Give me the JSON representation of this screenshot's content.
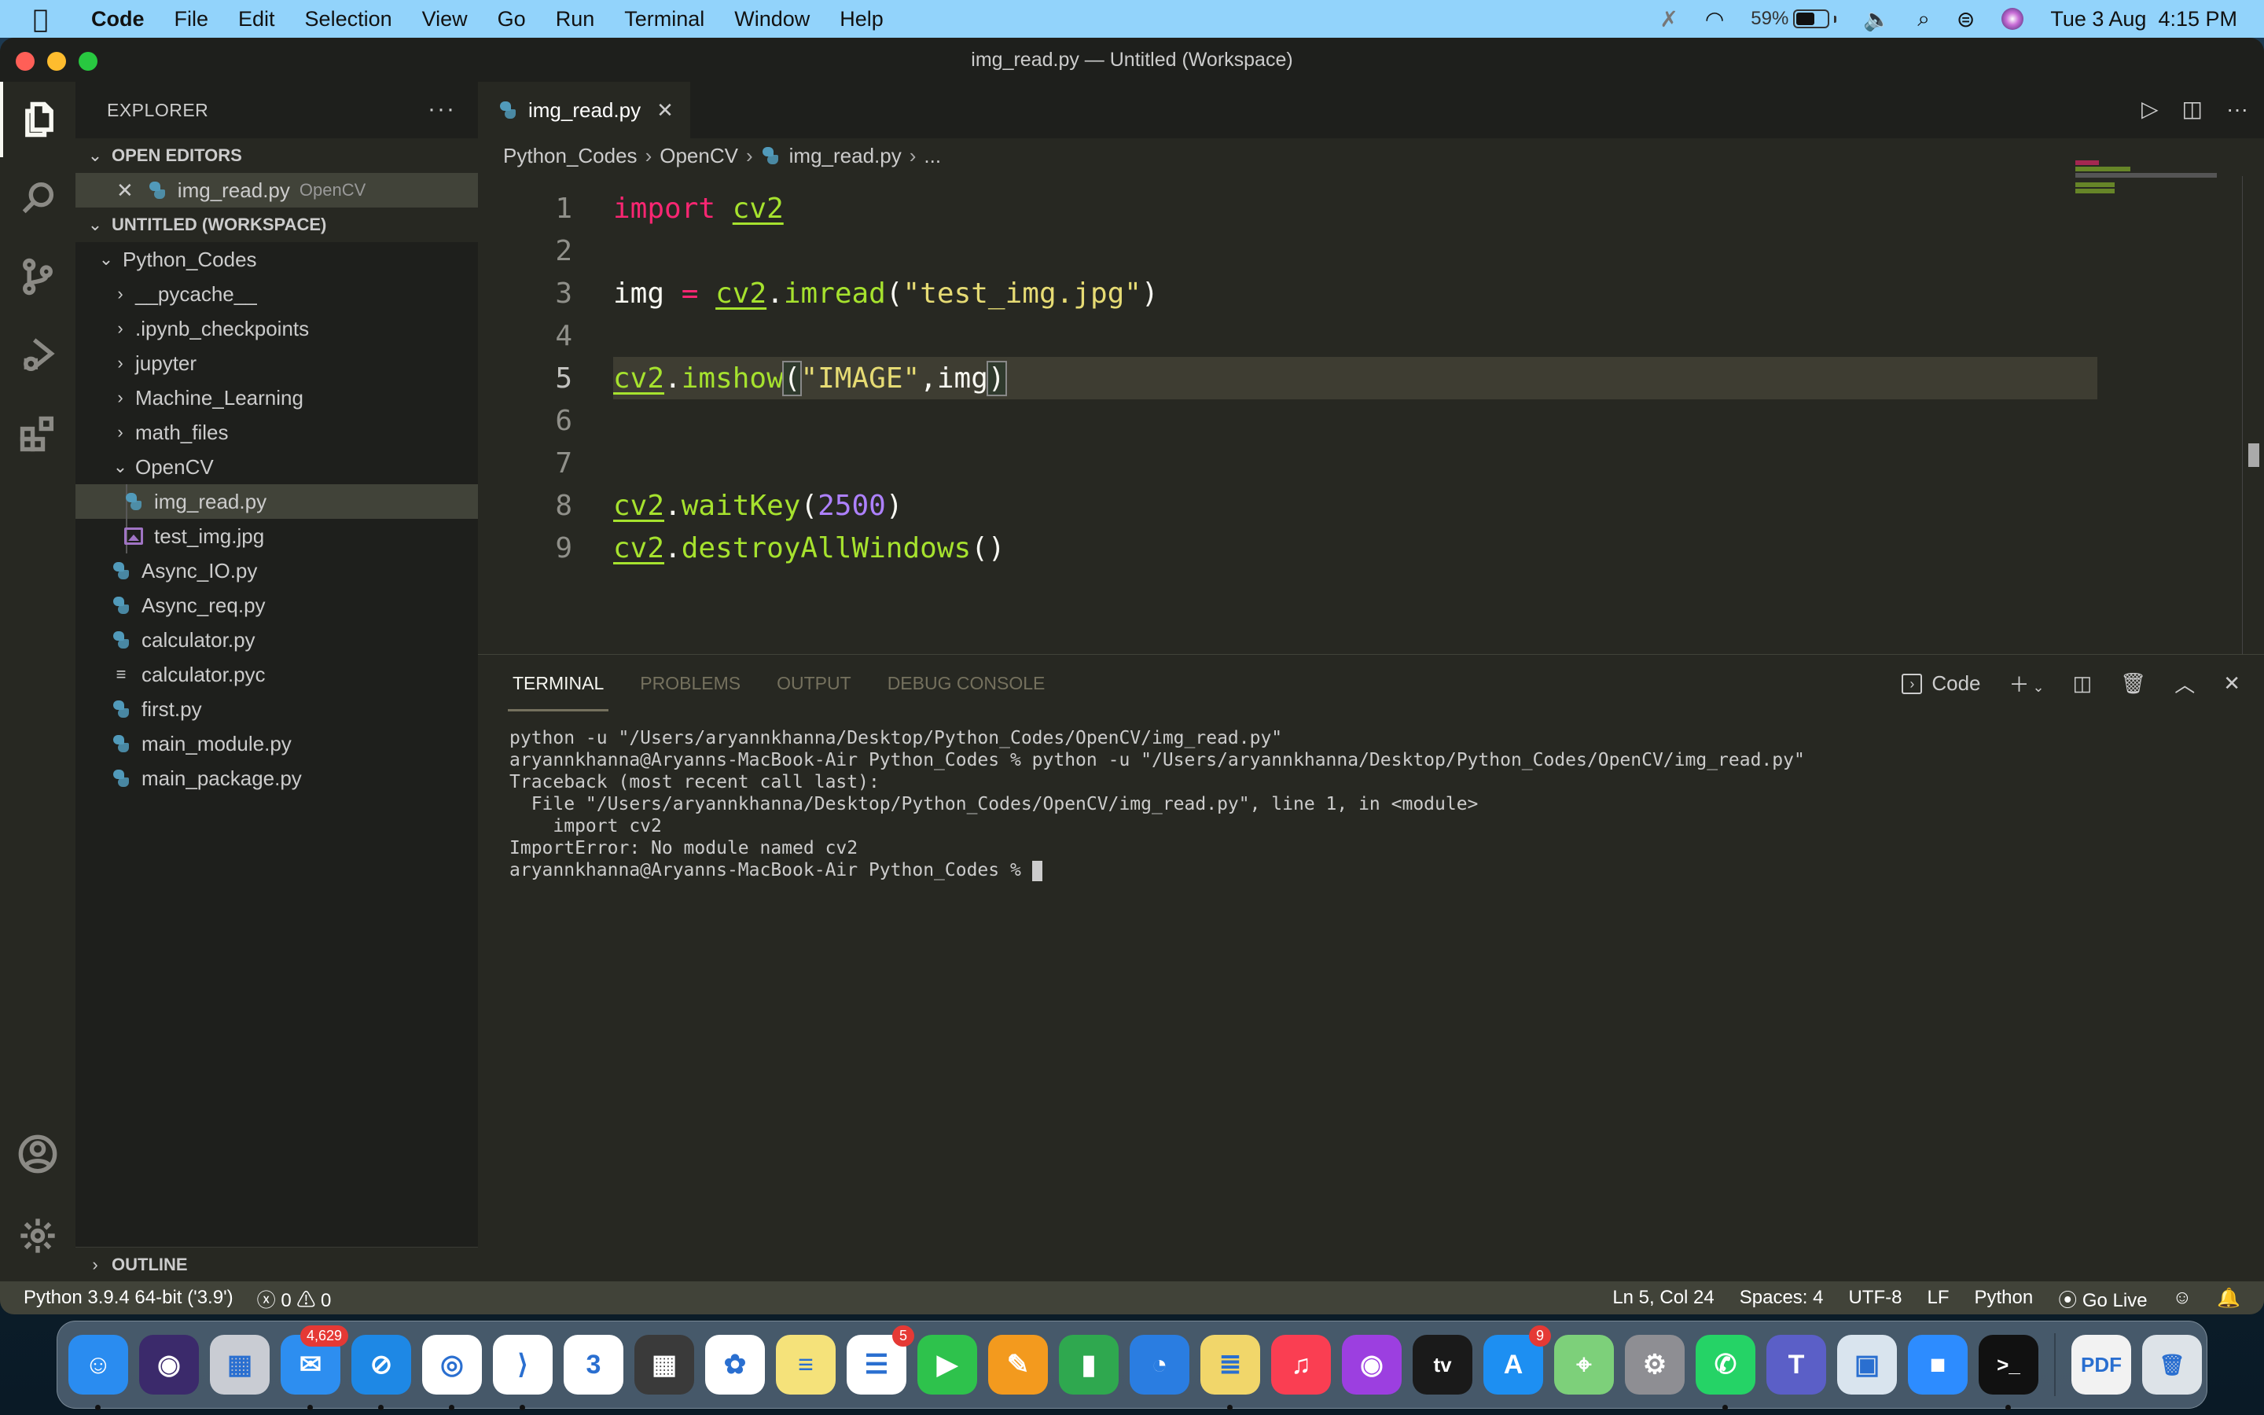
{
  "menubar": {
    "app": "Code",
    "items": [
      "File",
      "Edit",
      "Selection",
      "View",
      "Go",
      "Run",
      "Terminal",
      "Window",
      "Help"
    ],
    "battery_percent": "59%",
    "battery_level": 0.59,
    "datetime": "Tue 3 Aug  4:15 PM",
    "status_icons": [
      "bluetooth-off-icon",
      "wifi-icon",
      "battery-icon",
      "volume-icon",
      "spotlight-search-icon",
      "control-center-icon",
      "siri-icon"
    ]
  },
  "window": {
    "title": "img_read.py — Untitled (Workspace)"
  },
  "activitybar": [
    "explorer-icon",
    "search-icon",
    "source-control-icon",
    "run-debug-icon",
    "extensions-icon",
    "accounts-icon",
    "manage-gear-icon"
  ],
  "sidebar": {
    "header": "EXPLORER",
    "more": "···",
    "open_editors_label": "OPEN EDITORS",
    "open_editors": [
      {
        "name": "img_read.py",
        "desc": "OpenCV"
      }
    ],
    "workspace_label": "UNTITLED (WORKSPACE)",
    "root": "Python_Codes",
    "folders": [
      "__pycache__",
      ".ipynb_checkpoints",
      "jupyter",
      "Machine_Learning",
      "math_files"
    ],
    "open_folder": "OpenCV",
    "open_folder_files": [
      "img_read.py",
      "test_img.jpg"
    ],
    "files": [
      {
        "name": "Async_IO.py",
        "type": "python"
      },
      {
        "name": "Async_req.py",
        "type": "python"
      },
      {
        "name": "calculator.py",
        "type": "python"
      },
      {
        "name": "calculator.pyc",
        "type": "text"
      },
      {
        "name": "first.py",
        "type": "python"
      },
      {
        "name": "main_module.py",
        "type": "python"
      },
      {
        "name": "main_package.py",
        "type": "python"
      }
    ],
    "outline_label": "OUTLINE"
  },
  "editor": {
    "tab": "img_read.py",
    "breadcrumb": [
      "Python_Codes",
      "OpenCV",
      "img_read.py",
      "..."
    ],
    "line_numbers": [
      "1",
      "2",
      "3",
      "4",
      "5",
      "6",
      "7",
      "8",
      "9"
    ],
    "code": {
      "l1_kw": "import",
      "l1_mod": "cv2",
      "l3_var": "img",
      "l3_op": "=",
      "l3_mod": "cv2",
      "l3_fn": "imread",
      "l3_str": "\"test_img.jpg\"",
      "l5_mod": "cv2",
      "l5_fn": "imshow",
      "l5_str": "\"IMAGE\"",
      "l5_arg": "img",
      "l8_mod": "cv2",
      "l8_fn": "waitKey",
      "l8_num": "2500",
      "l9_mod": "cv2",
      "l9_fn": "destroyAllWindows"
    },
    "current_line": 5
  },
  "panel": {
    "tabs": [
      "TERMINAL",
      "PROBLEMS",
      "OUTPUT",
      "DEBUG CONSOLE"
    ],
    "active_tab": "TERMINAL",
    "shell_label": "Code",
    "terminal_lines": [
      "python -u \"/Users/aryannkhanna/Desktop/Python_Codes/OpenCV/img_read.py\"",
      "aryannkhanna@Aryanns-MacBook-Air Python_Codes % python -u \"/Users/aryannkhanna/Desktop/Python_Codes/OpenCV/img_read.py\"",
      "Traceback (most recent call last):",
      "  File \"/Users/aryannkhanna/Desktop/Python_Codes/OpenCV/img_read.py\", line 1, in <module>",
      "    import cv2",
      "ImportError: No module named cv2",
      "aryannkhanna@Aryanns-MacBook-Air Python_Codes % "
    ]
  },
  "statusbar": {
    "interpreter": "Python 3.9.4 64-bit ('3.9')",
    "errors": "0",
    "warnings": "0",
    "position": "Ln 5, Col 24",
    "spaces": "Spaces: 4",
    "encoding": "UTF-8",
    "eol": "LF",
    "language": "Python",
    "go_live": "Go Live"
  },
  "dock": {
    "apps": [
      {
        "name": "Finder",
        "color": "#2a8cf0",
        "glyph": "☺",
        "running": true
      },
      {
        "name": "Siri",
        "color": "#3b2a6b",
        "glyph": "◉",
        "running": false
      },
      {
        "name": "Launchpad",
        "color": "#c9ccd3",
        "glyph": "▦",
        "running": false
      },
      {
        "name": "Mail",
        "color": "#2d8ef0",
        "glyph": "✉",
        "badge": "4,629",
        "running": true
      },
      {
        "name": "Safari",
        "color": "#1e88e5",
        "glyph": "⊘",
        "running": true
      },
      {
        "name": "Chrome",
        "color": "#ffffff",
        "glyph": "◎",
        "running": true
      },
      {
        "name": "Visual Studio Code",
        "color": "#ffffff",
        "glyph": "⟩",
        "running": true
      },
      {
        "name": "Calendar",
        "color": "#ffffff",
        "glyph": "3",
        "running": false
      },
      {
        "name": "Calculator",
        "color": "#3a3a3a",
        "glyph": "▦",
        "running": false
      },
      {
        "name": "Photos",
        "color": "#ffffff",
        "glyph": "✿",
        "running": false
      },
      {
        "name": "Notes",
        "color": "#f5e27a",
        "glyph": "≡",
        "running": false
      },
      {
        "name": "Reminders",
        "color": "#ffffff",
        "glyph": "☰",
        "badge": "5",
        "running": false
      },
      {
        "name": "FaceTime",
        "color": "#2ec24c",
        "glyph": "▶",
        "running": false
      },
      {
        "name": "Pages",
        "color": "#f39a1e",
        "glyph": "✎",
        "running": false
      },
      {
        "name": "Numbers",
        "color": "#2fa84f",
        "glyph": "▮",
        "running": false
      },
      {
        "name": "Keynote",
        "color": "#2a7de1",
        "glyph": "◔",
        "running": false
      },
      {
        "name": "Stickies",
        "color": "#f1d66a",
        "glyph": "≣",
        "running": true
      },
      {
        "name": "Music",
        "color": "#fa3e52",
        "glyph": "♫",
        "running": false
      },
      {
        "name": "Podcasts",
        "color": "#9c3fe0",
        "glyph": "◉",
        "running": false
      },
      {
        "name": "TV",
        "color": "#1a1a1a",
        "glyph": "tv",
        "running": false
      },
      {
        "name": "App Store",
        "color": "#1d8ff2",
        "glyph": "A",
        "badge": "9",
        "running": false
      },
      {
        "name": "Maps",
        "color": "#7dd07a",
        "glyph": "⌖",
        "running": false
      },
      {
        "name": "System Preferences",
        "color": "#8e8e93",
        "glyph": "⚙",
        "running": false
      },
      {
        "name": "WhatsApp",
        "color": "#25d366",
        "glyph": "✆",
        "running": true
      },
      {
        "name": "Microsoft Teams",
        "color": "#5b5fc7",
        "glyph": "T",
        "running": false
      },
      {
        "name": "Preview",
        "color": "#d9e4ee",
        "glyph": "▣",
        "running": false
      },
      {
        "name": "Zoom",
        "color": "#2d8cff",
        "glyph": "■",
        "running": false
      },
      {
        "name": "Terminal",
        "color": "#111111",
        "glyph": ">_",
        "running": true
      }
    ],
    "others": [
      {
        "name": "PDF Document",
        "color": "#f2f2f2",
        "glyph": "PDF"
      },
      {
        "name": "Trash",
        "color": "#dde3e8",
        "glyph": "🗑"
      }
    ]
  }
}
